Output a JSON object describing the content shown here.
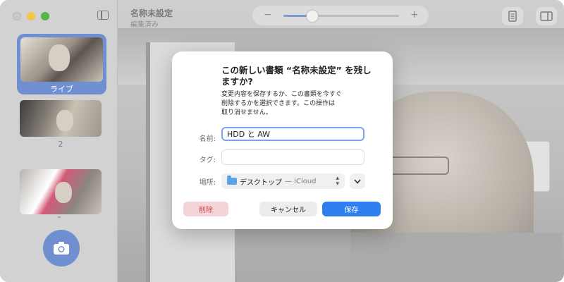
{
  "toolbar": {
    "title": "名称未設定",
    "subtitle": "編集済み",
    "zoom_minus": "−",
    "zoom_plus": "+",
    "zoom_level": 0.25
  },
  "sidebar": {
    "items": [
      {
        "label": "ライブ",
        "selected": true
      },
      {
        "label": "2",
        "selected": false
      },
      {
        "label": "",
        "selected": false
      }
    ],
    "more_indicator": "⌃"
  },
  "dialog": {
    "title": "この新しい書類 “名称未設定” を残しますか?",
    "message": "変更内容を保存するか、この書類を今すぐ\n削除するかを選択できます。この操作は\n取り消せません。",
    "name_label": "名前:",
    "name_value": "HDD と AW",
    "tags_label": "タグ:",
    "tags_value": "",
    "where_label": "場所:",
    "where_folder": "デスクトップ",
    "where_location": "— iCloud",
    "delete_label": "削除",
    "cancel_label": "キャンセル",
    "save_label": "保存"
  },
  "colors": {
    "accent": "#2f7ff0",
    "selected_thumb": "#6f8fd0",
    "delete_text": "#d9474f",
    "delete_bg": "#f3d5d8"
  }
}
